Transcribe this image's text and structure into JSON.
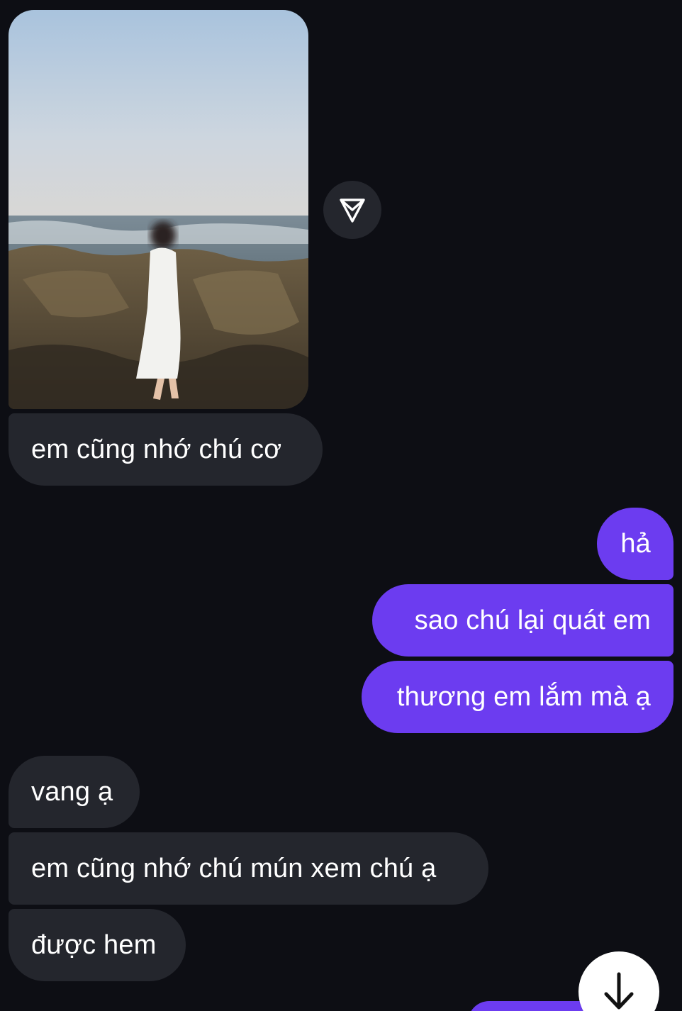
{
  "conversation": {
    "messages": [
      {
        "direction": "incoming",
        "text": "em cũng nhớ chú cơ"
      },
      {
        "direction": "outgoing",
        "text": "hả"
      },
      {
        "direction": "outgoing",
        "text": "sao chú lại quát em"
      },
      {
        "direction": "outgoing",
        "text": "thương em lắm mà ạ"
      },
      {
        "direction": "incoming",
        "text": "vang ạ"
      },
      {
        "direction": "incoming",
        "text": "em cũng nhớ chú mún xem chú ạ"
      },
      {
        "direction": "incoming",
        "text": "được hem"
      }
    ]
  },
  "icons": {
    "share": "paper-plane-icon",
    "scroll": "arrow-down-icon"
  },
  "colors": {
    "background": "#0d0e14",
    "incoming_bubble": "#24262d",
    "outgoing_bubble": "#6c3cf0",
    "text": "#ffffff"
  }
}
